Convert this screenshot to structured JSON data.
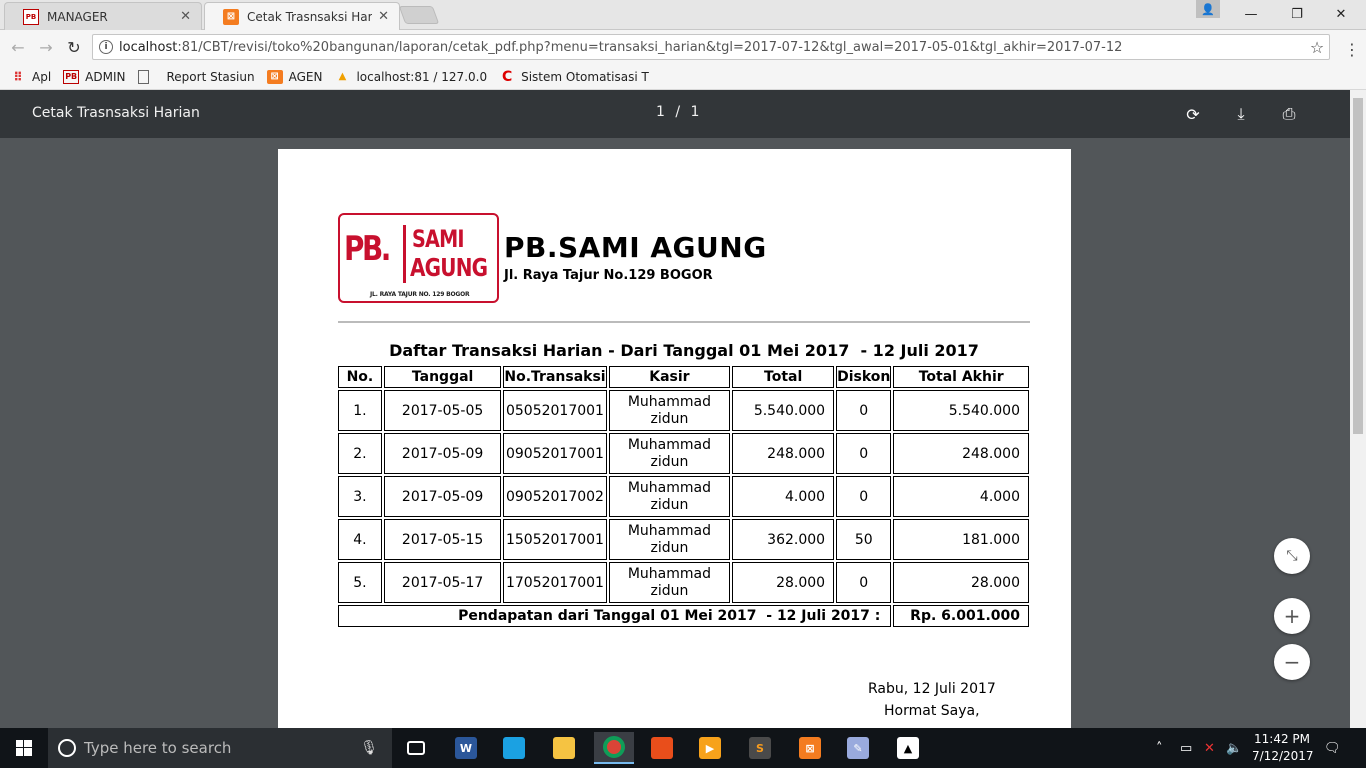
{
  "browser": {
    "tabs": [
      {
        "label": "MANAGER",
        "favicon": "pb-logo-icon"
      },
      {
        "label": "Cetak Trasnsaksi Harian",
        "favicon": "xampp-icon",
        "active": true
      }
    ],
    "url_host": "localhost",
    "url_rest": ":81/CBT/revisi/toko%20bangunan/laporan/cetak_pdf.php?menu=transaksi_harian&tgl=2017-07-12&tgl_awal=2017-05-01&tgl_akhir=2017-07-12",
    "bookmarks": [
      {
        "label": "Apl",
        "icon": "apps-grid-icon"
      },
      {
        "label": "ADMIN",
        "icon": "pb-logo-icon"
      },
      {
        "label": "Report Stasiun",
        "icon": "page-icon"
      },
      {
        "label": "AGEN",
        "icon": "xampp-icon"
      },
      {
        "label": "localhost:81 / 127.0.0",
        "icon": "pma-icon"
      },
      {
        "label": "Sistem Otomatisasi T",
        "icon": "red-c-icon"
      }
    ]
  },
  "pdf_viewer": {
    "title": "Cetak Trasnsaksi Harian",
    "current_page": "1",
    "separator": "/",
    "total_pages": "1"
  },
  "document": {
    "logo": {
      "pb": "PB.",
      "sami": "SAMI",
      "agung": "AGUNG",
      "address": "JL. RAYA TAJUR NO. 129 BOGOR"
    },
    "company_name": "PB.SAMI AGUNG",
    "company_address": "Jl. Raya Tajur No.129 BOGOR",
    "report_title": "Daftar Transaksi Harian - Dari Tanggal 01 Mei 2017  - 12 Juli 2017",
    "table": {
      "headers": [
        "No.",
        "Tanggal",
        "No.Transaksi",
        "Kasir",
        "Total",
        "Diskon",
        "Total Akhir"
      ],
      "rows": [
        {
          "no": "1.",
          "tanggal": "2017-05-05",
          "no_transaksi": "05052017001",
          "kasir_1": "Muhammad",
          "kasir_2": "zidun",
          "total": "5.540.000",
          "diskon": "0",
          "total_akhir": "5.540.000"
        },
        {
          "no": "2.",
          "tanggal": "2017-05-09",
          "no_transaksi": "09052017001",
          "kasir_1": "Muhammad",
          "kasir_2": "zidun",
          "total": "248.000",
          "diskon": "0",
          "total_akhir": "248.000"
        },
        {
          "no": "3.",
          "tanggal": "2017-05-09",
          "no_transaksi": "09052017002",
          "kasir_1": "Muhammad",
          "kasir_2": "zidun",
          "total": "4.000",
          "diskon": "0",
          "total_akhir": "4.000"
        },
        {
          "no": "4.",
          "tanggal": "2017-05-15",
          "no_transaksi": "15052017001",
          "kasir_1": "Muhammad",
          "kasir_2": "zidun",
          "total": "362.000",
          "diskon": "50",
          "total_akhir": "181.000"
        },
        {
          "no": "5.",
          "tanggal": "2017-05-17",
          "no_transaksi": "17052017001",
          "kasir_1": "Muhammad",
          "kasir_2": "zidun",
          "total": "28.000",
          "diskon": "0",
          "total_akhir": "28.000"
        }
      ],
      "summary_label": "Pendapatan dari Tanggal 01 Mei 2017  - 12 Juli 2017 :",
      "summary_value": "Rp. 6.001.000"
    },
    "sign_date": "Rabu, 12 Juli 2017",
    "sign_greeting": "Hormat Saya,"
  },
  "taskbar": {
    "search_placeholder": "Type here to search",
    "time": "11:42 PM",
    "date": "7/12/2017"
  },
  "colors": {
    "brand_red": "#c8102e",
    "pdf_toolbar": "#323639",
    "viewer_background": "#525659"
  }
}
